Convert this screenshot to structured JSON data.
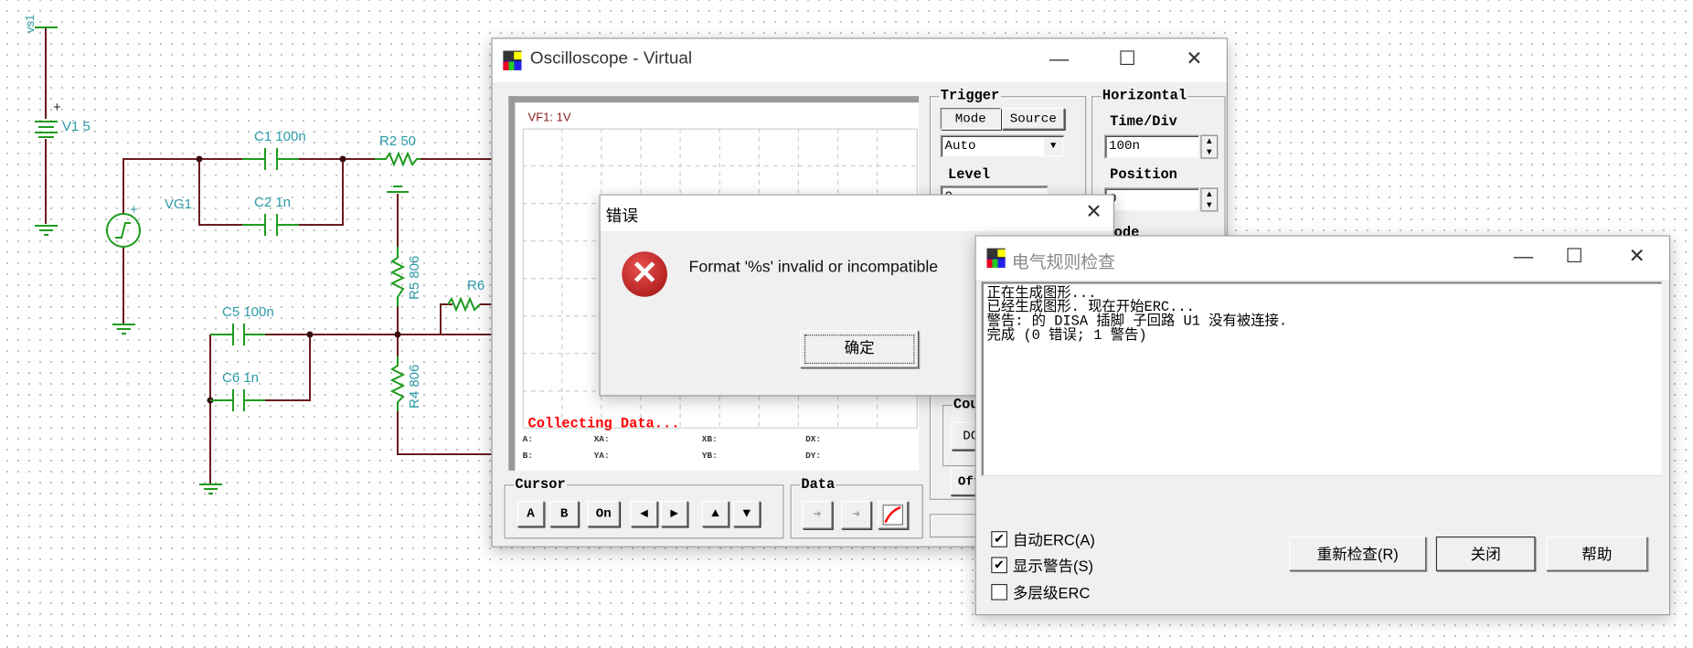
{
  "schematic": {
    "labels": {
      "vs1": "vs1",
      "v1": "V1 5",
      "vg1": "VG1",
      "c1": "C1 100n",
      "c2": "C2 1n",
      "r2": "R2 50",
      "r5": "R5 806",
      "r6": "R6",
      "c5": "C5 100n",
      "c6": "C6 1n",
      "r4": "R4 806",
      "plus": "+"
    },
    "colors": {
      "wire": "#6b1c1c",
      "component": "#1e9b1e",
      "label": "#2a9aa8",
      "pin": "#e02020"
    }
  },
  "oscilloscope": {
    "title": "Oscilloscope - Virtual",
    "channel_label": "VF1: 1V",
    "status": "Collecting Data...",
    "readouts": [
      "A:",
      "XA:",
      "XB:",
      "DX:",
      "B:",
      "YA:",
      "YB:",
      "DY:"
    ],
    "cursor": {
      "legend": "Cursor",
      "buttons": [
        "A",
        "B",
        "On"
      ]
    },
    "data": {
      "legend": "Data"
    },
    "trigger": {
      "legend": "Trigger",
      "tabs": [
        "Mode",
        "Source"
      ],
      "mode_value": "Auto",
      "level_label": "Level",
      "level_value": "0",
      "coupling_legend": "Coupling",
      "coupling_value": "DC",
      "other_button": "Off"
    },
    "horizontal": {
      "legend": "Horizontal",
      "time_div_label": "Time/Div",
      "time_div_value": "100n",
      "position_label": "Position",
      "position_value": "0",
      "mode_label": "Mode"
    }
  },
  "error_dialog": {
    "title": "错误",
    "message": "Format '%s' invalid or incompatible",
    "ok_label": "确定",
    "icon": "error-icon"
  },
  "erc": {
    "title": "电气规则检查",
    "log": [
      "正在生成图形...",
      "已经生成图形. 现在开始ERC...",
      "警告: 的 DISA 插脚 子回路 U1 没有被连接.",
      "完成 (0 错误; 1 警告)"
    ],
    "checkboxes": [
      {
        "label": "自动ERC(A)",
        "checked": true
      },
      {
        "label": "显示警告(S)",
        "checked": true
      },
      {
        "label": "多层级ERC",
        "checked": false
      }
    ],
    "buttons": {
      "recheck": "重新检查(R)",
      "close": "关闭",
      "help": "帮助"
    }
  }
}
